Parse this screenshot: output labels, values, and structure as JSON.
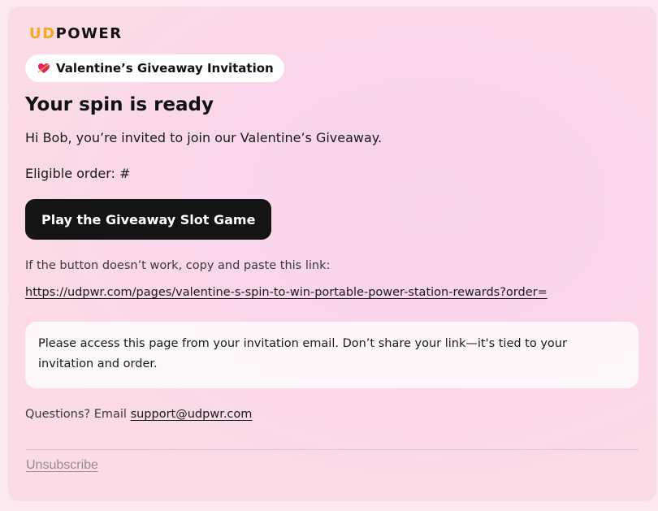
{
  "brand": {
    "logo_part1": "UD",
    "logo_part2": "POWER",
    "accent_color": "#f3a91f"
  },
  "badge": {
    "icon": "heart-arrow-icon",
    "label": "Valentine’s Giveaway Invitation"
  },
  "content": {
    "title": "Your spin is ready",
    "greeting": "Hi Bob, you’re invited to join our Valentine’s Giveaway.",
    "order_label": "Eligible order: #",
    "cta_label": "Play the Giveaway Slot Game",
    "fallback_hint": "If the button doesn’t work, copy and paste this link:",
    "fallback_link": "https://udpwr.com/pages/valentine-s-spin-to-win-portable-power-station-rewards?order=",
    "notice": "Please access this page from your invitation email. Don’t share your link—it's tied to your invitation and order.",
    "questions_prefix": "Questions? Email ",
    "support_email": "support@udpwr.com"
  },
  "footer": {
    "unsubscribe": "Unsubscribe"
  },
  "colors": {
    "button_bg": "#141414",
    "button_text": "#ffffff",
    "background": "#f9d6ea"
  }
}
